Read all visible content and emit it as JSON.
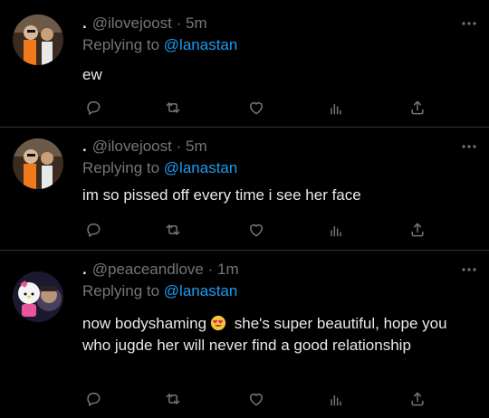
{
  "tweets": [
    {
      "handle": "@ilovejoost",
      "time": "5m",
      "replying_prefix": "Replying to",
      "replying_to": "@lanastan",
      "text": "ew",
      "avatar": "avatar-photo-person-orange"
    },
    {
      "handle": "@ilovejoost",
      "time": "5m",
      "replying_prefix": "Replying to",
      "replying_to": "@lanastan",
      "text": "im so pissed off every time i see her face",
      "avatar": "avatar-photo-person-orange"
    },
    {
      "handle": "@peaceandlove",
      "time": "1m",
      "replying_prefix": "Replying to",
      "replying_to": "@lanastan",
      "text_before_emoji": "now bodyshaming",
      "emoji": "heart-eyes-emoji",
      "text_after_emoji": " she's super beautiful, hope you who jugde her will never find a good relationship",
      "avatar": "avatar-photo-hello-kitty"
    }
  ],
  "display_name_dot": ".",
  "separator": "·",
  "icons": {
    "reply": "reply-icon",
    "retweet": "retweet-icon",
    "like": "heart-icon",
    "analytics": "analytics-icon",
    "share": "share-icon",
    "more": "more-icon"
  },
  "colors": {
    "background": "#000000",
    "text": "#e7e9ea",
    "muted": "#71767b",
    "link": "#1d9bf0",
    "divider": "#2f3336"
  }
}
